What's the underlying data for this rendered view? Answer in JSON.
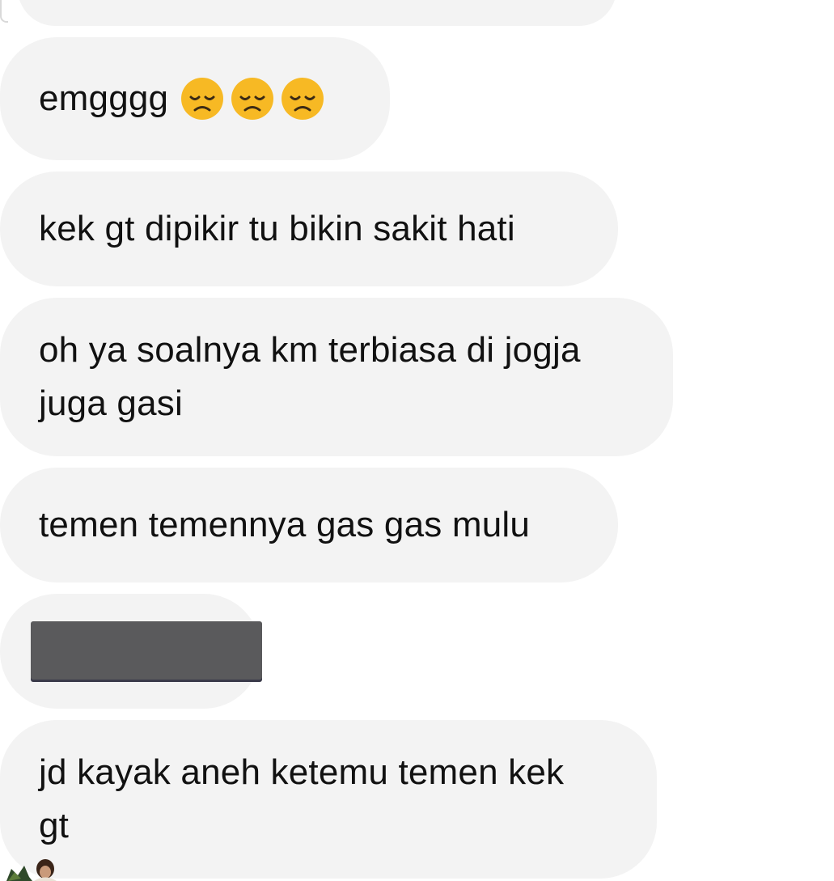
{
  "messages": [
    {
      "text": ""
    },
    {
      "text": "emgggg",
      "emoji": [
        "disappointed-face",
        "disappointed-face",
        "disappointed-face"
      ]
    },
    {
      "text": "kek gt dipikir tu bikin sakit hati"
    },
    {
      "text": "oh ya soalnya km terbiasa di jogja\njuga gasi"
    },
    {
      "text": "temen temennya gas gas mulu"
    },
    {
      "redacted": true
    },
    {
      "text": "jd kayak aneh ketemu temen kek\ngt"
    }
  ],
  "colors": {
    "bubble": "#f3f3f3",
    "text": "#111111",
    "redaction": "#5a5a5c",
    "emoji_face": "#f7b924"
  }
}
